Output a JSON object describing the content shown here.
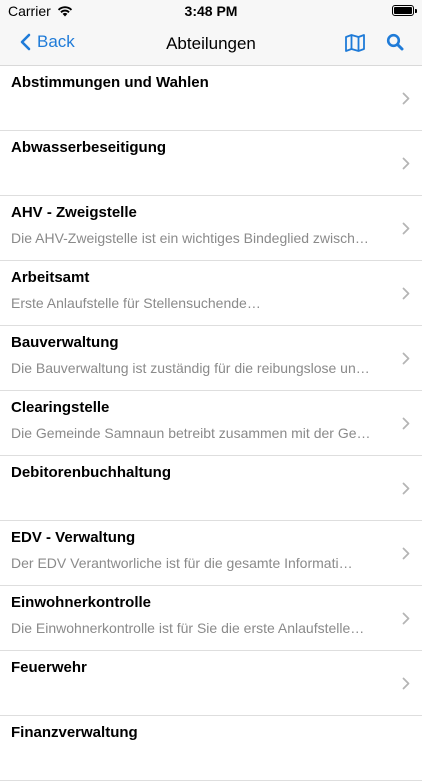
{
  "status": {
    "carrier": "Carrier",
    "time": "3:48 PM"
  },
  "nav": {
    "back_label": "Back",
    "title": "Abteilungen"
  },
  "departments": [
    {
      "title": "Abstimmungen und Wahlen",
      "subtitle": ""
    },
    {
      "title": "Abwasserbeseitigung",
      "subtitle": ""
    },
    {
      "title": "AHV - Zweigstelle",
      "subtitle": "Die AHV-Zweigstelle ist ein wichtiges Bindeglied zwisch…"
    },
    {
      "title": "Arbeitsamt",
      "subtitle": "Erste Anlaufstelle für Stellensuchende…"
    },
    {
      "title": "Bauverwaltung",
      "subtitle": "Die Bauverwaltung ist zuständig für die reibungslose un…"
    },
    {
      "title": "Clearingstelle",
      "subtitle": "Die Gemeinde Samnaun betreibt zusammen mit der Ge…"
    },
    {
      "title": "Debitorenbuchhaltung",
      "subtitle": ""
    },
    {
      "title": "EDV - Verwaltung",
      "subtitle": "Der EDV Verantworliche ist für die gesamte Informati…"
    },
    {
      "title": "Einwohnerkontrolle",
      "subtitle": "Die Einwohnerkontrolle ist für Sie die erste Anlaufstelle…"
    },
    {
      "title": "Feuerwehr",
      "subtitle": ""
    },
    {
      "title": "Finanzverwaltung",
      "subtitle": ""
    }
  ],
  "colors": {
    "accent": "#1f7bd8",
    "subtitle": "#8a8a8a",
    "bar": "#f7f7f7"
  }
}
